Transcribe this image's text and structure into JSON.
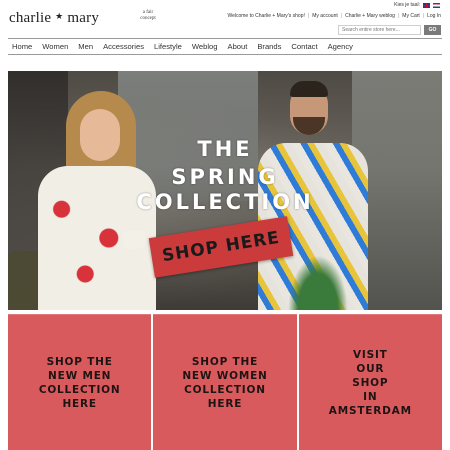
{
  "header": {
    "logo_name": "charlie",
    "logo_star": "★",
    "logo_name2": "mary",
    "tagline": "a fair concept",
    "lang_label": "Kies je taal:",
    "top_links": [
      "Welcome to Charlie + Mary's shop!",
      "My account",
      "Charlie + Mary weblog",
      "My Cart",
      "Log In"
    ],
    "search": {
      "placeholder": "Search entire store here...",
      "button": "GO"
    }
  },
  "nav": {
    "items": [
      "Home",
      "Women",
      "Men",
      "Accessories",
      "Lifestyle",
      "Weblog",
      "About",
      "Brands",
      "Contact",
      "Agency"
    ]
  },
  "hero": {
    "line1": "THE",
    "line2": "SPRING",
    "line3": "COLLECTION",
    "cta": "SHOP HERE"
  },
  "tiles": [
    "SHOP THE\nNEW MEN\nCOLLECTION\nHERE",
    "SHOP THE\nNEW WOMEN\nCOLLECTION\nHERE",
    "VISIT\nOUR\nSHOP\nIN\nAMSTERDAM"
  ],
  "colors": {
    "tile": "#d95a5c",
    "cta": "#cc3b3c"
  }
}
